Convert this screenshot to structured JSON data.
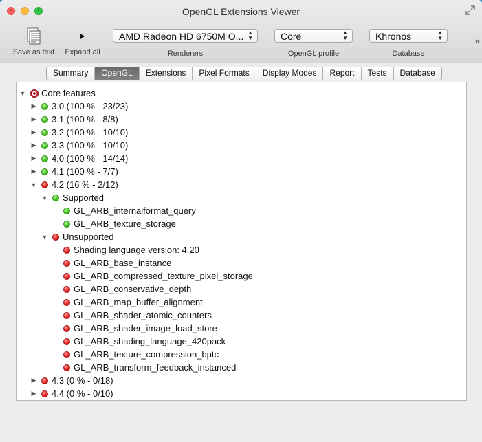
{
  "window": {
    "title": "OpenGL Extensions Viewer"
  },
  "toolbar": {
    "save_label": "Save as text",
    "expand_label": "Expand all",
    "renderer": {
      "value": "AMD Radeon HD 6750M O...",
      "caption": "Renderers"
    },
    "profile": {
      "value": "Core",
      "caption": "OpenGL profile"
    },
    "database": {
      "value": "Khronos",
      "caption": "Database"
    },
    "overflow": "»"
  },
  "tabs": [
    {
      "label": "Summary",
      "active": false
    },
    {
      "label": "OpenGL",
      "active": true
    },
    {
      "label": "Extensions",
      "active": false
    },
    {
      "label": "Pixel Formats",
      "active": false
    },
    {
      "label": "Display Modes",
      "active": false
    },
    {
      "label": "Report",
      "active": false
    },
    {
      "label": "Tests",
      "active": false
    },
    {
      "label": "Database",
      "active": false
    }
  ],
  "tree": {
    "root": {
      "label": "Core features",
      "expanded": true
    },
    "versions": [
      {
        "label": "3.0 (100 % - 23/23)",
        "status": "green",
        "expanded": false
      },
      {
        "label": "3.1 (100 % - 8/8)",
        "status": "green",
        "expanded": false
      },
      {
        "label": "3.2 (100 % - 10/10)",
        "status": "green",
        "expanded": false
      },
      {
        "label": "3.3 (100 % - 10/10)",
        "status": "green",
        "expanded": false
      },
      {
        "label": "4.0 (100 % - 14/14)",
        "status": "green",
        "expanded": false
      },
      {
        "label": "4.1 (100 % - 7/7)",
        "status": "green",
        "expanded": false
      },
      {
        "label": "4.2 (16 % - 2/12)",
        "status": "red",
        "expanded": true
      },
      {
        "label": "4.3 (0 % - 0/18)",
        "status": "red",
        "expanded": false
      },
      {
        "label": "4.4 (0 % - 0/10)",
        "status": "red",
        "expanded": false
      }
    ],
    "supported": {
      "label": "Supported",
      "items": [
        "GL_ARB_internalformat_query",
        "GL_ARB_texture_storage"
      ]
    },
    "unsupported": {
      "label": "Unsupported",
      "items": [
        "Shading language version: 4.20",
        "GL_ARB_base_instance",
        "GL_ARB_compressed_texture_pixel_storage",
        "GL_ARB_conservative_depth",
        "GL_ARB_map_buffer_alignment",
        "GL_ARB_shader_atomic_counters",
        "GL_ARB_shader_image_load_store",
        "GL_ARB_shading_language_420pack",
        "GL_ARB_texture_compression_bptc",
        "GL_ARB_transform_feedback_instanced"
      ]
    }
  },
  "colors": {
    "supported": "#3fc21c",
    "unsupported": "#e51d1d",
    "active_tab": "#737373"
  }
}
